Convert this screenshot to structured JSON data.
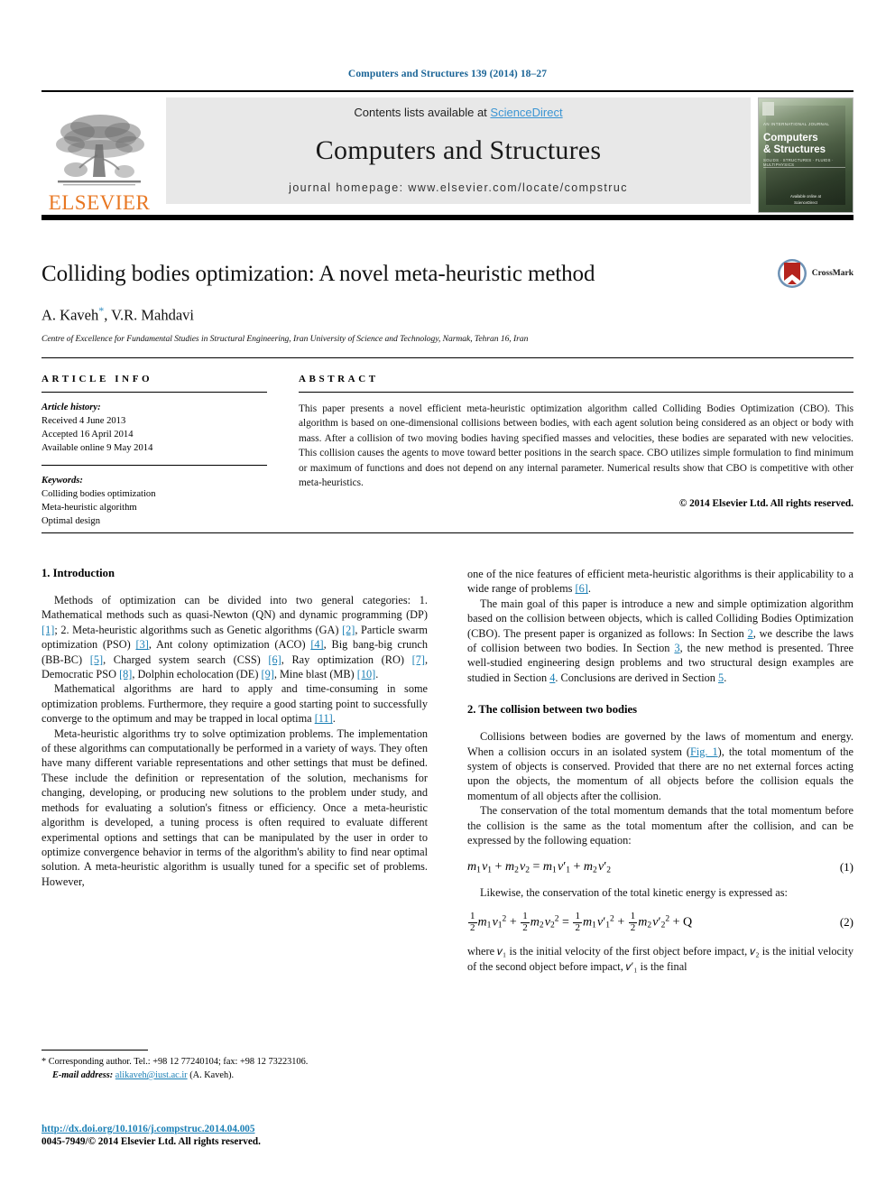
{
  "running_head": "Computers and Structures 139 (2014) 18–27",
  "masthead": {
    "contents_prefix": "Contents lists available at ",
    "sciencedirect": "ScienceDirect",
    "journal_name": "Computers and Structures",
    "homepage": "journal homepage: www.elsevier.com/locate/compstruc",
    "publisher_wordmark": "ELSEVIER",
    "cover": {
      "sub_label": "AN INTERNATIONAL JOURNAL",
      "title_line1": "Computers",
      "title_line2": "& Structures",
      "tagline": "SOLIDS · STRUCTURES · FLUIDS · MULTIPHYSICS",
      "footer_line1": "Available online at",
      "footer_line2": "ScienceDirect"
    }
  },
  "title": "Colliding bodies optimization: A novel meta-heuristic method",
  "authors": "A. Kaveh",
  "authors_rest": ", V.R. Mahdavi",
  "corresponding_mark": "*",
  "affiliation": "Centre of Excellence for Fundamental Studies in Structural Engineering, Iran University of Science and Technology, Narmak, Tehran 16, Iran",
  "crossmark_label": "CrossMark",
  "article_info": {
    "heading": "ARTICLE INFO",
    "history_label": "Article history:",
    "history": [
      "Received 4 June 2013",
      "Accepted 16 April 2014",
      "Available online 9 May 2014"
    ],
    "keywords_label": "Keywords:",
    "keywords": [
      "Colliding bodies optimization",
      "Meta-heuristic algorithm",
      "Optimal design"
    ]
  },
  "abstract": {
    "heading": "ABSTRACT",
    "text": "This paper presents a novel efficient meta-heuristic optimization algorithm called Colliding Bodies Optimization (CBO). This algorithm is based on one-dimensional collisions between bodies, with each agent solution being considered as an object or body with mass. After a collision of two moving bodies having specified masses and velocities, these bodies are separated with new velocities. This collision causes the agents to move toward better positions in the search space. CBO utilizes simple formulation to find minimum or maximum of functions and does not depend on any internal parameter. Numerical results show that CBO is competitive with other meta-heuristics.",
    "copyright": "© 2014 Elsevier Ltd. All rights reserved."
  },
  "sections": {
    "intro_heading": "1. Introduction",
    "intro_p1_a": "Methods of optimization can be divided into two general categories: 1. Mathematical methods such as quasi-Newton (QN) and dynamic programming (DP) ",
    "intro_p1_r1": "[1]",
    "intro_p1_b": "; 2. Meta-heuristic algorithms such as Genetic algorithms (GA) ",
    "intro_p1_r2": "[2]",
    "intro_p1_c": ", Particle swarm optimization (PSO) ",
    "intro_p1_r3": "[3]",
    "intro_p1_d": ", Ant colony optimization (ACO) ",
    "intro_p1_r4": "[4]",
    "intro_p1_e": ", Big bang-big crunch (BB-BC) ",
    "intro_p1_r5": "[5]",
    "intro_p1_f": ", Charged system search (CSS) ",
    "intro_p1_r6": "[6]",
    "intro_p1_g": ", Ray optimization (RO) ",
    "intro_p1_r7": "[7]",
    "intro_p1_h": ", Democratic PSO ",
    "intro_p1_r8": "[8]",
    "intro_p1_i": ", Dolphin echolocation (DE) ",
    "intro_p1_r9": "[9]",
    "intro_p1_j": ", Mine blast (MB) ",
    "intro_p1_r10": "[10]",
    "intro_p1_k": ".",
    "intro_p2_a": "Mathematical algorithms are hard to apply and time-consuming in some optimization problems. Furthermore, they require a good starting point to successfully converge to the optimum and may be trapped in local optima ",
    "intro_p2_r1": "[11]",
    "intro_p2_b": ".",
    "intro_p3": "Meta-heuristic algorithms try to solve optimization problems. The implementation of these algorithms can computationally be performed in a variety of ways. They often have many different variable representations and other settings that must be defined. These include the definition or representation of the solution, mechanisms for changing, developing, or producing new solutions to the problem under study, and methods for evaluating a solution's fitness or efficiency. Once a meta-heuristic algorithm is developed, a tuning process is often required to evaluate different experimental options and settings that can be manipulated by the user in order to optimize convergence behavior in terms of the algorithm's ability to find near optimal solution. A meta-heuristic algorithm is usually tuned for a specific set of problems. However,",
    "right_p1_a": "one of the nice features of efficient meta-heuristic algorithms is their applicability to a wide range of problems ",
    "right_p1_r1": "[6]",
    "right_p1_b": ".",
    "right_p2_a": "The main goal of this paper is introduce a new and simple optimization algorithm based on the collision between objects, which is called Colliding Bodies Optimization (CBO). The present paper is organized as follows: In Section ",
    "right_p2_r1": "2",
    "right_p2_b": ", we describe the laws of collision between two bodies. In Section ",
    "right_p2_r2": "3",
    "right_p2_c": ", the new method is presented. Three well-studied engineering design problems and two structural design examples are studied in Section ",
    "right_p2_r3": "4",
    "right_p2_d": ". Conclusions are derived in Section ",
    "right_p2_r4": "5",
    "right_p2_e": ".",
    "collision_heading": "2. The collision between two bodies",
    "collision_p1_a": "Collisions between bodies are governed by the laws of momentum and energy. When a collision occurs in an isolated system (",
    "collision_p1_r1": "Fig. 1",
    "collision_p1_b": "), the total momentum of the system of objects is conserved. Provided that there are no net external forces acting upon the objects, the momentum of all objects before the collision equals the momentum of all objects after the collision.",
    "collision_p2": "The conservation of the total momentum demands that the total momentum before the collision is the same as the total momentum after the collision, and can be expressed by the following equation:",
    "eq1_number": "(1)",
    "collision_p3": "Likewise, the conservation of the total kinetic energy is expressed as:",
    "eq2_number": "(2)",
    "collision_p4": "where 𝑣₁ is the initial velocity of the first object before impact, 𝑣₂ is the initial velocity of the second object before impact, 𝑣′₁ is the final"
  },
  "footnote": {
    "mark": "*",
    "corresponding": "Corresponding author. Tel.: +98 12 77240104; fax: +98 12 73223106.",
    "email_label": "E-mail address:",
    "email": "alikaveh@iust.ac.ir",
    "email_suffix": "(A. Kaveh)."
  },
  "footer": {
    "doi": "http://dx.doi.org/10.1016/j.compstruc.2014.04.005",
    "issn": "0045-7949/© 2014 Elsevier Ltd. All rights reserved."
  },
  "colors": {
    "link_blue": "#1a7fb5",
    "sciencedirect_blue": "#3b95d3",
    "elsevier_orange": "#E87722",
    "crossmark_red": "#B5241E",
    "crossmark_blue": "#4a7fae"
  }
}
